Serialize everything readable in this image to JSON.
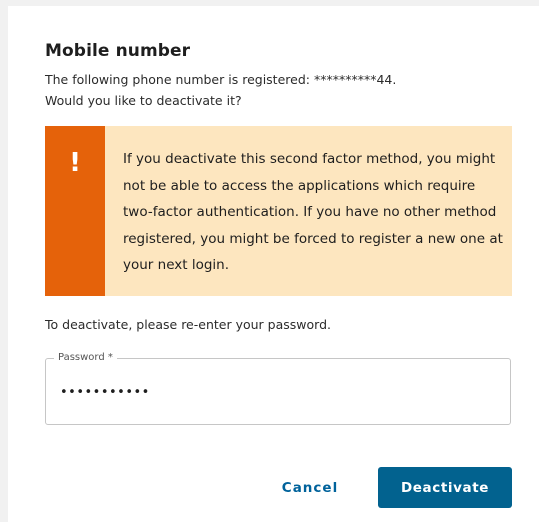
{
  "dialog": {
    "title": "Mobile number",
    "description_line1": "The following phone number is registered: **********44.",
    "description_line2": "Would you like to deactivate it?",
    "warning": {
      "icon": "exclamation-icon",
      "icon_glyph": "!",
      "text": "If you deactivate this second factor method, you might not be able to access the applications which require two-factor authentication. If you have no other method registered, you might be forced to register a new one at your next login.",
      "accent_color": "#e5620a",
      "background_color": "#fde6bf"
    },
    "reenter_prompt": "To deactivate, please re-enter your password.",
    "password_field": {
      "label": "Password *",
      "value": "•••••••••••"
    },
    "buttons": {
      "cancel_label": "Cancel",
      "deactivate_label": "Deactivate"
    },
    "primary_color": "#02628f"
  }
}
